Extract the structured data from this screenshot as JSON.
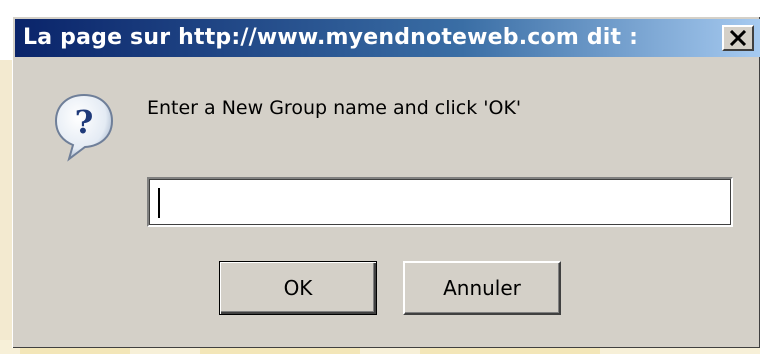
{
  "dialog": {
    "title": "La page sur http://www.myendnoteweb.com dit :",
    "close_icon": "close-icon",
    "prompt_icon": "question-icon",
    "prompt": "Enter a New Group name and click 'OK'",
    "input": {
      "value": "",
      "placeholder": ""
    },
    "buttons": {
      "ok_label": "OK",
      "cancel_label": "Annuler"
    }
  },
  "colors": {
    "titlebar_start": "#0a246a",
    "titlebar_end": "#a6caf0",
    "dialog_face": "#d4d0c8"
  }
}
